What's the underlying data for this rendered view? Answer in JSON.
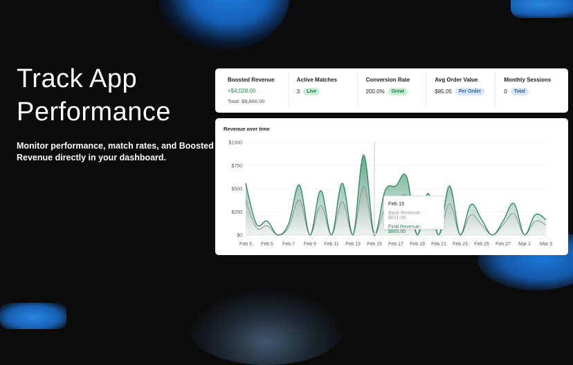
{
  "hero": {
    "title_line1": "Track App",
    "title_line2": "Performance",
    "subtitle": "Monitor performance, match rates, and Boosted Revenue directly in your dashboard."
  },
  "stats": [
    {
      "label": "Boosted Revenue",
      "value": "+$4,028.00",
      "sub": "Total: $9,866.00"
    },
    {
      "label": "Active Matches",
      "value": "3",
      "badge": "Live"
    },
    {
      "label": "Conversion Rate",
      "value": "200.0%",
      "badge": "Great"
    },
    {
      "label": "Avg Order Value",
      "value": "$85.05",
      "badge": "Per Order"
    },
    {
      "label": "Monthly Sessions",
      "value": "0",
      "badge": "Total"
    }
  ],
  "colors": {
    "final": "#2e8b62",
    "base": "#8f8f8f",
    "badge_green_bg": "#c9f0d6",
    "badge_blue_bg": "#d6e7fb"
  },
  "chart_data": {
    "type": "area",
    "title": "Revenue over time",
    "x": [
      "Feb 3",
      "Feb 4",
      "Feb 5",
      "Feb 6",
      "Feb 7",
      "Feb 8",
      "Feb 9",
      "Feb 10",
      "Feb 11",
      "Feb 12",
      "Feb 13",
      "Feb 14",
      "Feb 15",
      "Feb 16",
      "Feb 17",
      "Feb 18",
      "Feb 19",
      "Feb 20",
      "Feb 21",
      "Feb 22",
      "Feb 23",
      "Feb 24",
      "Feb 25",
      "Feb 26",
      "Feb 27",
      "Feb 28",
      "Mar 1",
      "Mar 2",
      "Mar 3"
    ],
    "xticks": [
      "Feb 3",
      "Feb 5",
      "Feb 7",
      "Feb 9",
      "Feb 11",
      "Feb 13",
      "Feb 15",
      "Feb 17",
      "Feb 19",
      "Feb 21",
      "Feb 23",
      "Feb 25",
      "Feb 27",
      "Mar 1",
      "Mar 3"
    ],
    "yticks": [
      "$0",
      "$250",
      "$500",
      "$750",
      "$1000"
    ],
    "ylim": [
      0,
      1000
    ],
    "series": [
      {
        "name": "Final Revenue",
        "values": [
          560,
          120,
          150,
          0,
          120,
          540,
          0,
          480,
          0,
          560,
          0,
          865,
          0,
          480,
          530,
          630,
          0,
          450,
          0,
          530,
          0,
          330,
          165,
          0,
          150,
          340,
          0,
          220,
          165
        ]
      },
      {
        "name": "Base Revenue",
        "values": [
          380,
          80,
          100,
          0,
          80,
          380,
          0,
          320,
          0,
          360,
          0,
          531,
          0,
          300,
          350,
          420,
          0,
          300,
          0,
          340,
          0,
          220,
          110,
          0,
          110,
          230,
          0,
          150,
          110
        ]
      }
    ],
    "tooltip": {
      "date": "Feb 15",
      "base": "Base Revenue : $531.00",
      "final": "Final Revenue : $865.00"
    }
  }
}
